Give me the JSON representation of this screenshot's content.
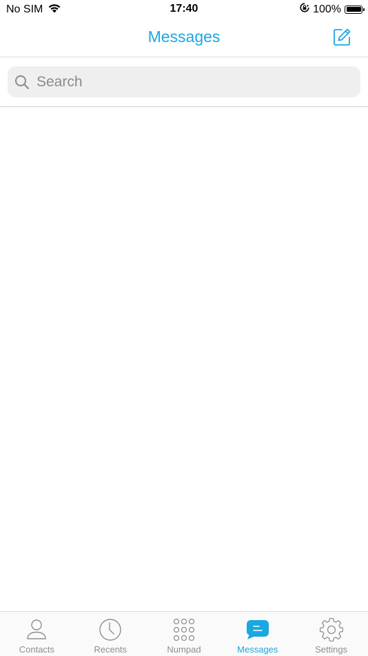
{
  "status_bar": {
    "carrier": "No SIM",
    "time": "17:40",
    "battery": "100%"
  },
  "nav": {
    "title": "Messages"
  },
  "search": {
    "placeholder": "Search"
  },
  "tabs": [
    {
      "label": "Contacts",
      "icon": "person-icon",
      "active": false
    },
    {
      "label": "Recents",
      "icon": "clock-icon",
      "active": false
    },
    {
      "label": "Numpad",
      "icon": "keypad-icon",
      "active": false
    },
    {
      "label": "Messages",
      "icon": "chat-bubble-icon",
      "active": true
    },
    {
      "label": "Settings",
      "icon": "gear-icon",
      "active": false
    }
  ],
  "colors": {
    "accent": "#19a8e0",
    "inactive": "#8e8e93"
  }
}
